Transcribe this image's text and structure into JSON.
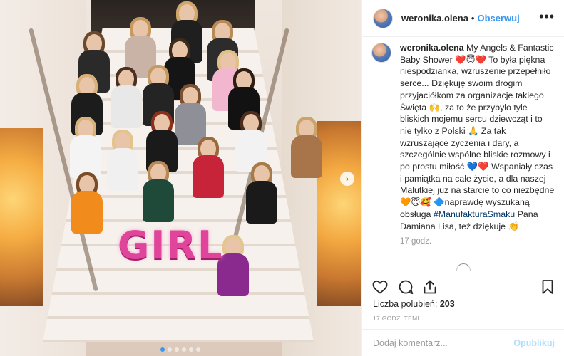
{
  "post_image": {
    "balloon_letters": [
      "G",
      "I",
      "R",
      "L"
    ],
    "carousel_dots": 6,
    "active_dot": 0
  },
  "header": {
    "username": "weronika.olena",
    "separator": "•",
    "follow_label": "Obserwuj",
    "more_label": "•••"
  },
  "caption": {
    "username": "weronika.olena",
    "text_part1": "My Angels & Fantastic Baby Shower ❤️😇❤️ To była piękna niespodzianka, wzruszenie przepełniło serce... Dziękuję swoim drogim przyjaciółkom za organizacje takiego Święta 🙌, za to że przybyło tyle bliskich mojemu sercu dziewcząt i to nie tylko z Polski 🙏 Za tak wzruszające życzenia i dary, a szczególnie wspólne bliskie rozmowy i po prostu miłość 💙❤️ Wspaniały czas i pamiątka na całe życie, a dla naszej Malutkiej już na starcie to co niezbędne 🧡😇🥰 🔷naprawdę wyszukaną obsługa ",
    "hashtag": "#ManufakturaSmaku",
    "text_part2": " Pana Damiana Lisa, też dziękuje 👏",
    "time": "17 godz."
  },
  "likes": {
    "label": "Liczba polubień:",
    "count": "203"
  },
  "timestamp": "17 GODZ. TEMU",
  "comment": {
    "placeholder": "Dodaj komentarz...",
    "publish_label": "Opublikuj"
  },
  "colors": {
    "accent": "#3897f0",
    "publish_disabled": "#b2dffc",
    "border": "#efefef",
    "muted": "#999999"
  }
}
